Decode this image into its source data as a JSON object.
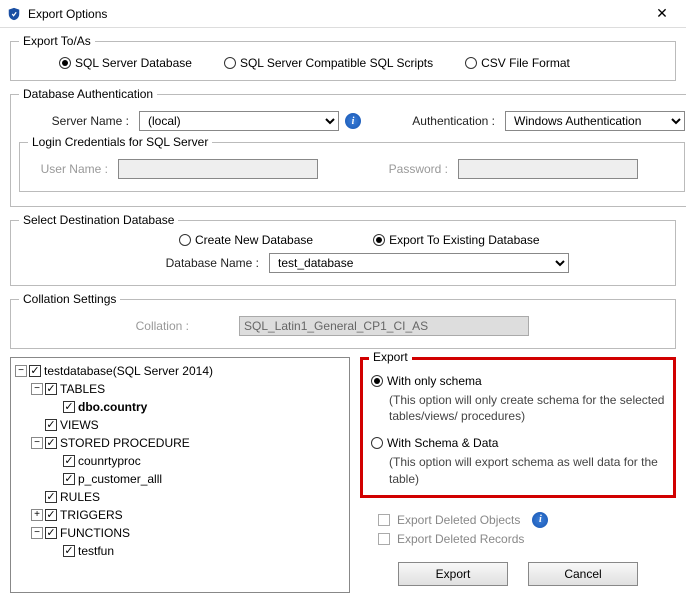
{
  "window": {
    "title": "Export Options",
    "close_glyph": "✕"
  },
  "export_to": {
    "legend": "Export To/As",
    "options": [
      "SQL Server Database",
      "SQL Server Compatible SQL Scripts",
      "CSV File Format"
    ],
    "selected": 0
  },
  "db_auth": {
    "legend": "Database Authentication",
    "server_label": "Server Name :",
    "server_value": "(local)",
    "auth_label": "Authentication :",
    "auth_value": "Windows Authentication",
    "login": {
      "legend": "Login Credentials for SQL Server",
      "user_label": "User Name :",
      "pass_label": "Password :"
    }
  },
  "dest": {
    "legend": "Select Destination Database",
    "create_label": "Create New Database",
    "existing_label": "Export To Existing Database",
    "selected": "existing",
    "dbname_label": "Database Name :",
    "dbname_value": "test_database"
  },
  "collation": {
    "legend": "Collation Settings",
    "label": "Collation :",
    "value": "SQL_Latin1_General_CP1_CI_AS"
  },
  "tree": {
    "root": "testdatabase(SQL Server 2014)",
    "nodes": {
      "tables": "TABLES",
      "dbo_country": "dbo.country",
      "views": "VIEWS",
      "sp": "STORED PROCEDURE",
      "counrtyproc": "counrtyproc",
      "p_customer_alll": "p_customer_alll",
      "rules": "RULES",
      "triggers": "TRIGGERS",
      "functions": "FUNCTIONS",
      "testfun": "testfun"
    }
  },
  "export": {
    "legend": "Export",
    "only_schema": "With only schema",
    "only_schema_desc": "(This option will only create schema for the  selected tables/views/ procedures)",
    "schema_data": "With Schema & Data",
    "schema_data_desc": "(This option will export schema as well data for the table)",
    "selected": "only_schema",
    "deleted_objects": "Export Deleted Objects",
    "deleted_records": "Export Deleted Records"
  },
  "buttons": {
    "export": "Export",
    "cancel": "Cancel"
  }
}
